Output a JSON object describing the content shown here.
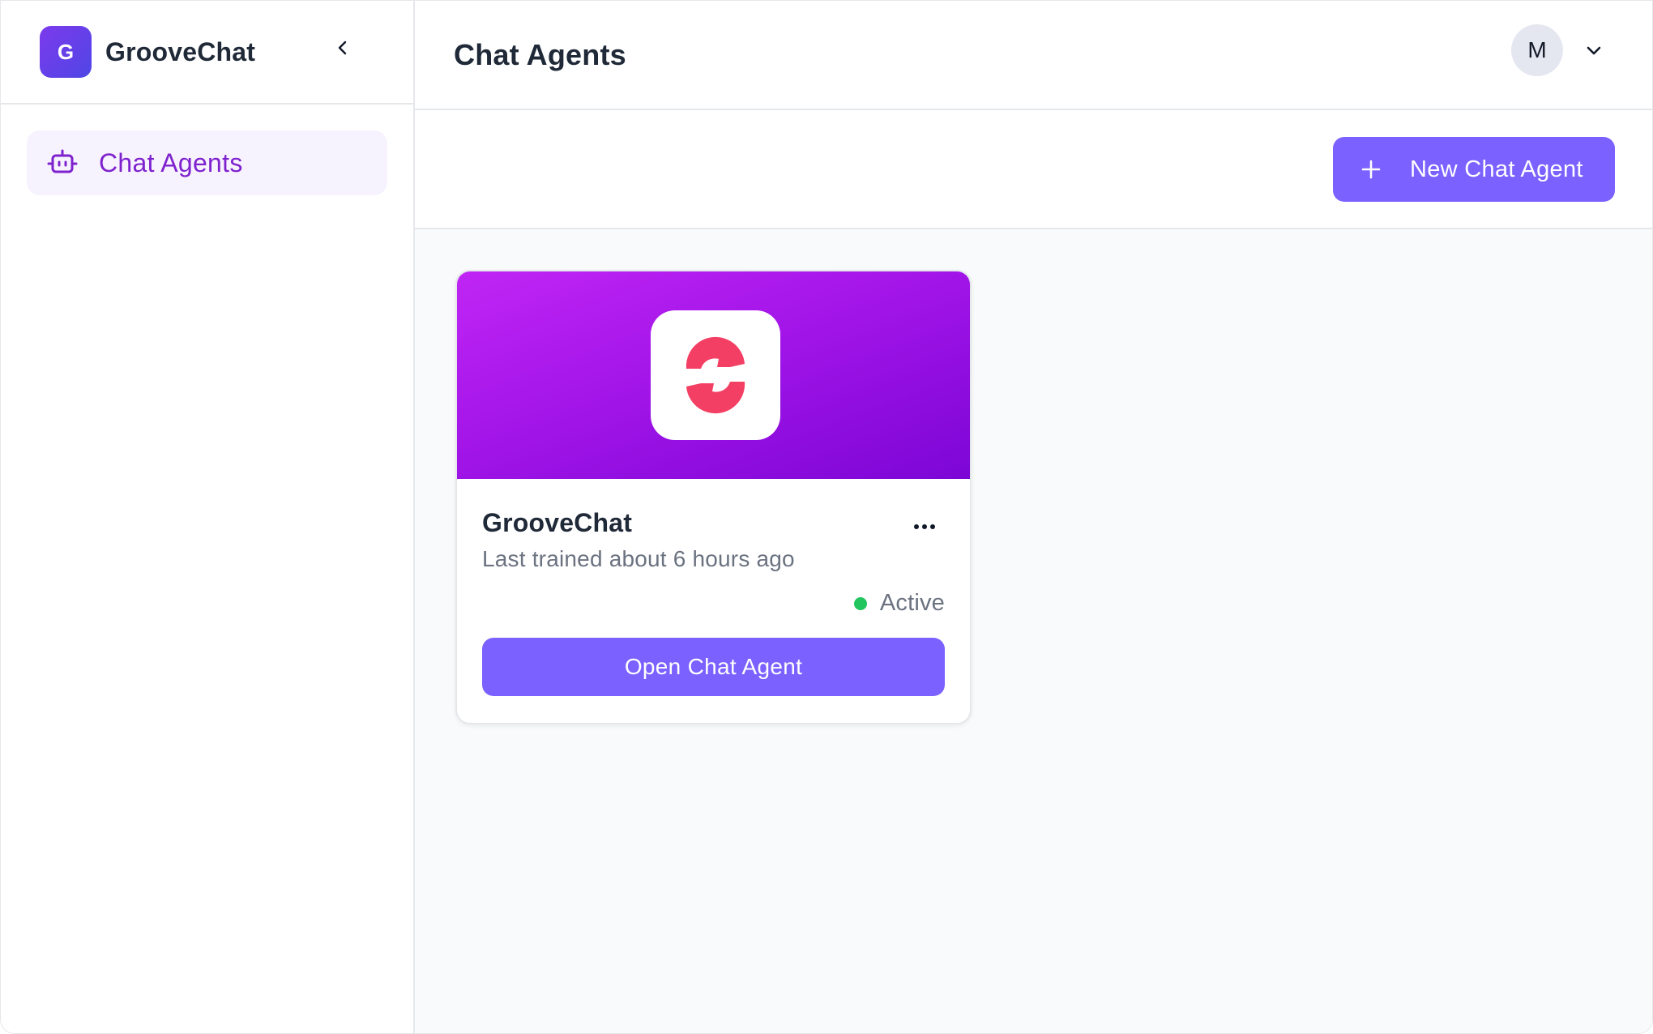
{
  "brand": {
    "logo_letter": "G",
    "name": "GrooveChat"
  },
  "sidebar": {
    "items": [
      {
        "label": "Chat Agents",
        "icon": "robot-icon",
        "active": true
      }
    ]
  },
  "header": {
    "title": "Chat Agents",
    "user_initial": "M"
  },
  "toolbar": {
    "new_agent_label": "New Chat Agent"
  },
  "agents": [
    {
      "name": "GrooveChat",
      "trained": "Last trained about 6 hours ago",
      "status": "Active",
      "open_label": "Open Chat Agent"
    }
  ],
  "colors": {
    "accent": "#7b61ff",
    "nav_active_text": "#7e22ce",
    "banner_start": "#c026f5",
    "banner_end": "#7c06d6",
    "status_active": "#22c55e",
    "logo_mark": "#f43f64"
  }
}
